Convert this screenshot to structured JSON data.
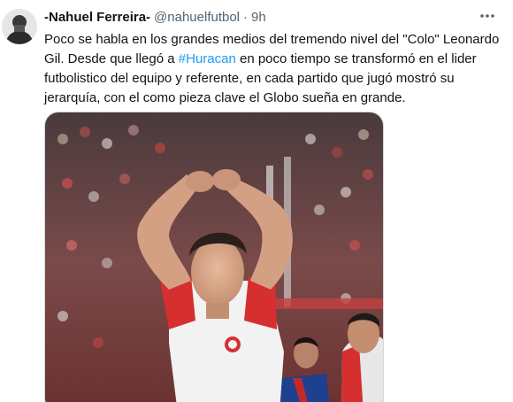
{
  "tweet": {
    "display_name": "-Nahuel Ferreira-",
    "handle": "@nahuelfutbol",
    "separator": "·",
    "time": "9h",
    "text_part1": "Poco se habla en los grandes medios del tremendo nivel del \"Colo\" Leonardo Gil. Desde que llegó a ",
    "hashtag": "#Huracan",
    "text_part2": " en poco tiempo se transformó en el lider futbolistico del equipo y referente, en cada partido que jugó mostró su jerarquía, con el como pieza clave el Globo sueña en grande."
  },
  "icons": {
    "more": "more-horizontal-icon"
  },
  "colors": {
    "link": "#1d9bf0",
    "secondary_text": "#536471",
    "jersey_red": "#d62f2f"
  }
}
